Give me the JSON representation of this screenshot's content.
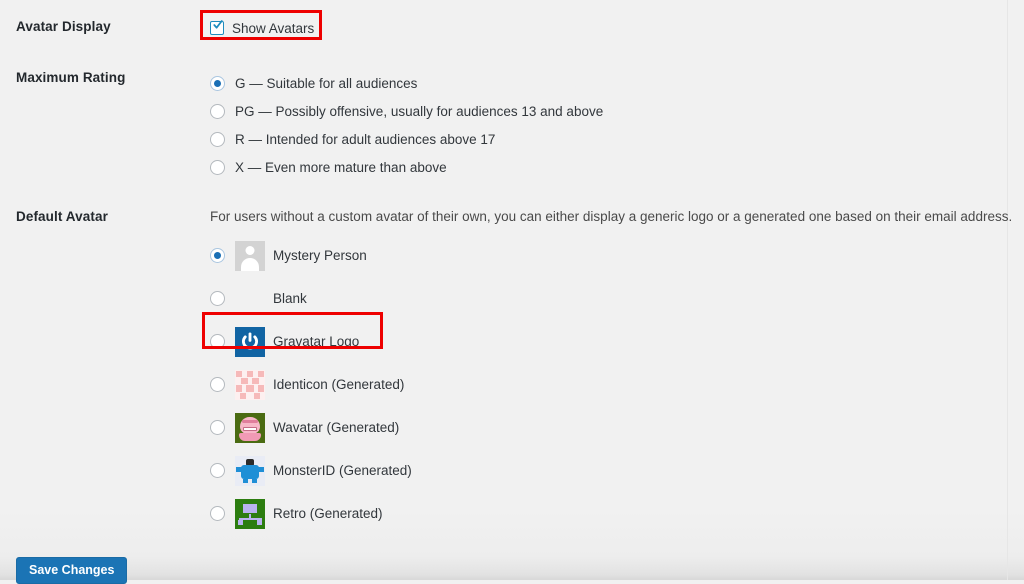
{
  "page": {
    "background_color": "#f1f1f1",
    "accent_color": "#1b74b5",
    "annotation_color": "#ee0000"
  },
  "rows": {
    "avatar_display": {
      "label": "Avatar Display",
      "checkbox": {
        "label": "Show Avatars",
        "checked": true,
        "icon": "checkmark-icon"
      }
    },
    "maximum_rating": {
      "label": "Maximum Rating",
      "options": [
        {
          "label": "G — Suitable for all audiences",
          "checked": true
        },
        {
          "label": "PG — Possibly offensive, usually for audiences 13 and above",
          "checked": false
        },
        {
          "label": "R — Intended for adult audiences above 17",
          "checked": false
        },
        {
          "label": "X — Even more mature than above",
          "checked": false
        }
      ]
    },
    "default_avatar": {
      "label": "Default Avatar",
      "description": "For users without a custom avatar of their own, you can either display a generic logo or a generated one based on their email address.",
      "options": [
        {
          "label": "Mystery Person",
          "checked": true,
          "icon": "mystery-person-avatar-icon"
        },
        {
          "label": "Blank",
          "checked": false,
          "icon": "blank-avatar-icon"
        },
        {
          "label": "Gravatar Logo",
          "checked": false,
          "icon": "gravatar-logo-icon"
        },
        {
          "label": "Identicon (Generated)",
          "checked": false,
          "icon": "identicon-avatar-icon"
        },
        {
          "label": "Wavatar (Generated)",
          "checked": false,
          "icon": "wavatar-avatar-icon"
        },
        {
          "label": "MonsterID (Generated)",
          "checked": false,
          "icon": "monsterid-avatar-icon"
        },
        {
          "label": "Retro (Generated)",
          "checked": false,
          "icon": "retro-avatar-icon"
        }
      ]
    }
  },
  "footer": {
    "save_label": "Save Changes"
  },
  "annotations": [
    {
      "name": "show-avatars-highlight",
      "target": "Show Avatars"
    },
    {
      "name": "gravatar-logo-highlight",
      "target": "Gravatar Logo"
    }
  ]
}
